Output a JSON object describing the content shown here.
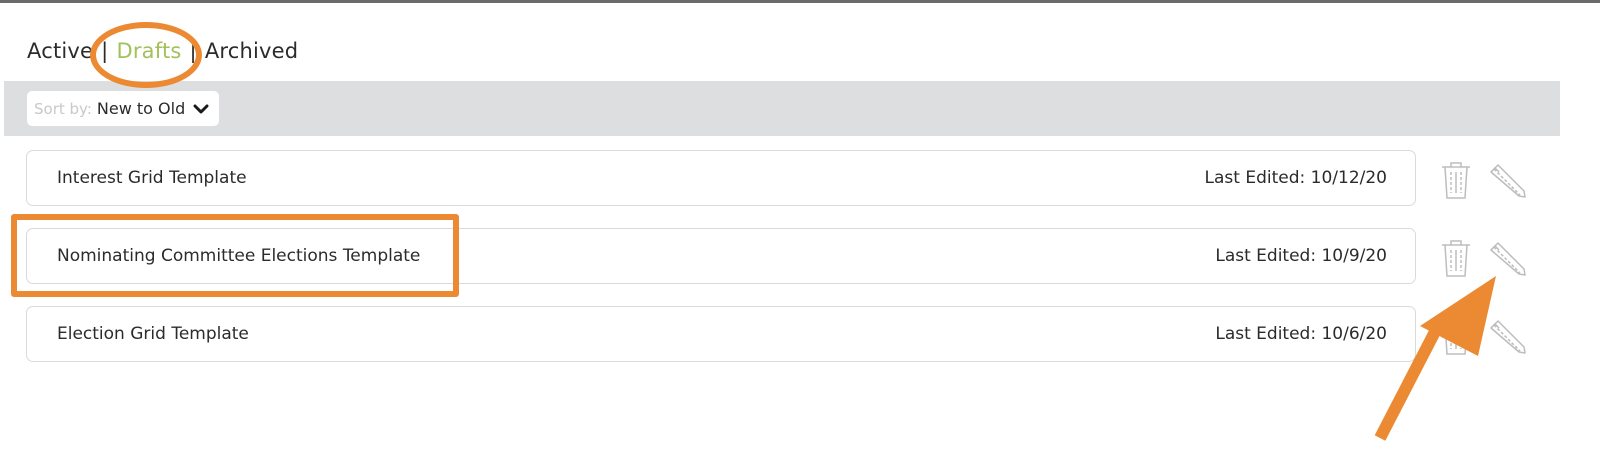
{
  "tabs": {
    "items": [
      {
        "label": "Active"
      },
      {
        "label": "Drafts"
      },
      {
        "label": "Archived"
      }
    ],
    "active_index": 1,
    "separator": "|"
  },
  "sort": {
    "prefix": "Sort by:",
    "value": "New to Old"
  },
  "rows": [
    {
      "name": "Interest Grid Template",
      "edited": "Last Edited: 10/12/20"
    },
    {
      "name": "Nominating Committee Elections Template",
      "edited": "Last Edited: 10/9/20"
    },
    {
      "name": "Election Grid Template",
      "edited": "Last Edited: 10/6/20"
    }
  ],
  "icons": {
    "delete": "trash-icon",
    "edit": "pencil-icon",
    "sort": "chevron-down-icon"
  },
  "colors": {
    "active_tab": "#a3c15a",
    "highlight": "#ec8a34",
    "sort_bar": "#dcdedf",
    "icon_stroke": "#bdbdbd"
  }
}
